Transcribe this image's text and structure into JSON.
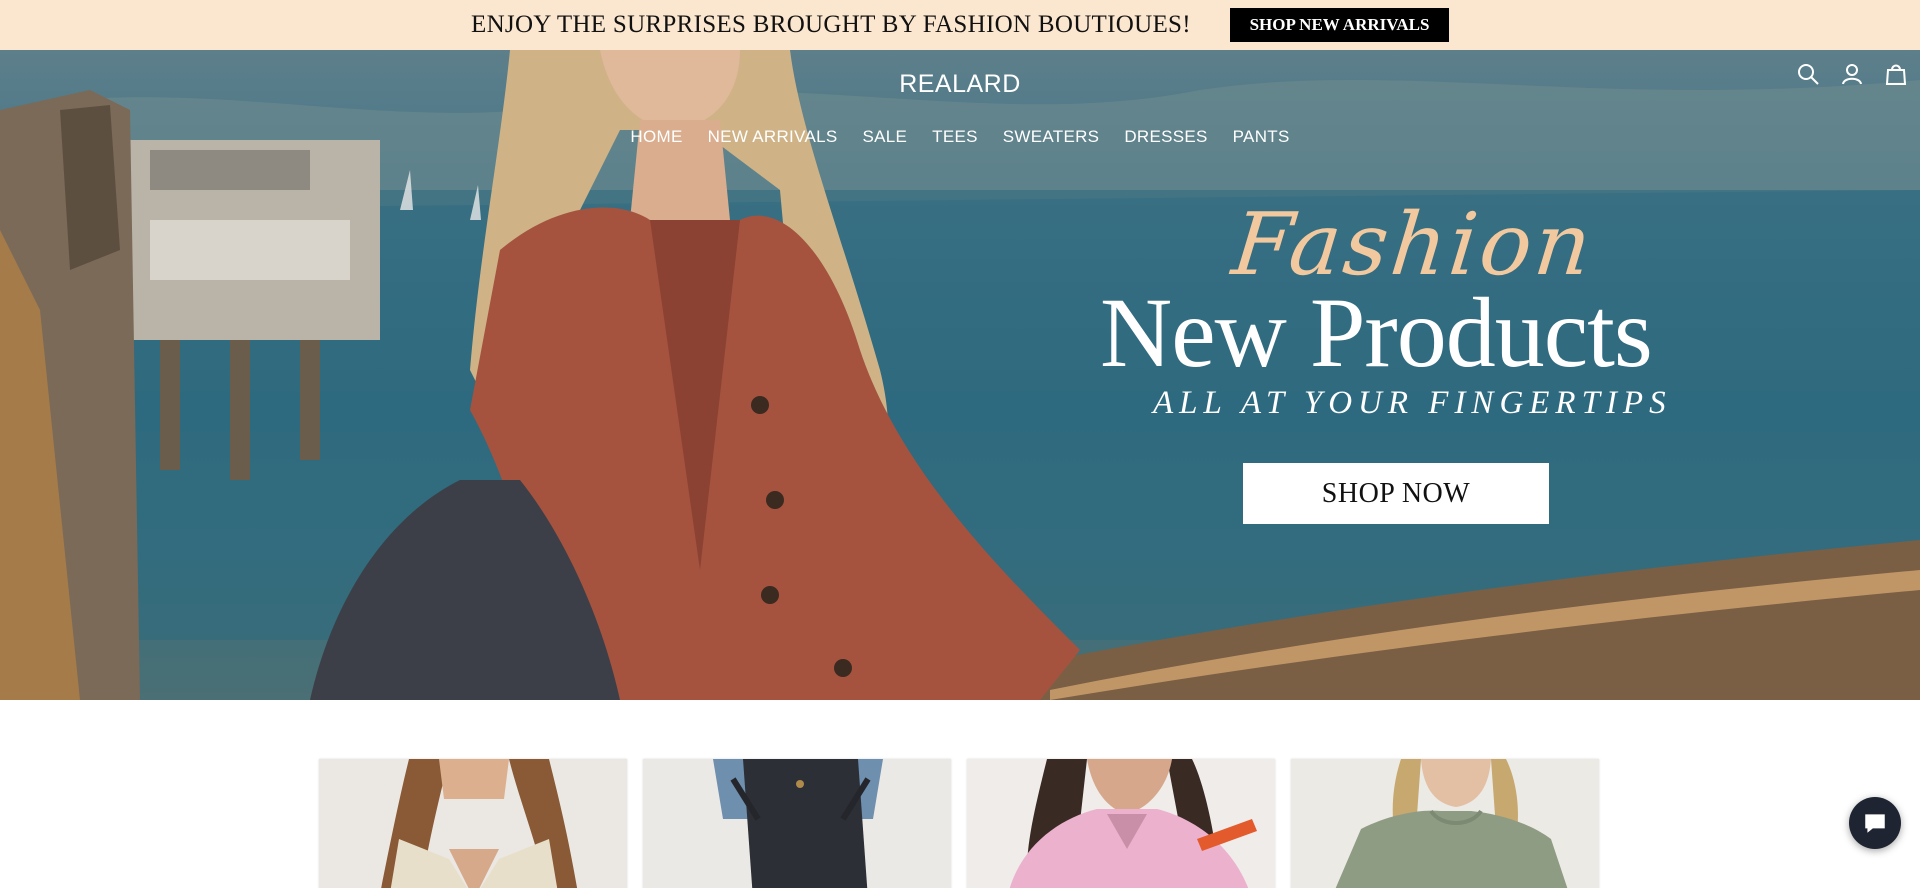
{
  "announcement": {
    "text": "ENJOY THE SURPRISES BROUGHT BY FASHION BOUTIOUES!",
    "button_label": "SHOP NEW ARRIVALS",
    "background": "#fbe6cf"
  },
  "header": {
    "brand": "REALARD",
    "nav": [
      "HOME",
      "NEW ARRIVALS",
      "SALE",
      "TEES",
      "SWEATERS",
      "DRESSES",
      "PANTS"
    ],
    "icons": [
      "search-icon",
      "account-icon",
      "cart-icon"
    ]
  },
  "hero": {
    "script_title": "Fashion",
    "title": "New Products",
    "subtitle": "ALL AT YOUR FINGERTIPS",
    "cta_label": "SHOP NOW",
    "accent": "#f2c89e"
  },
  "products": [
    {
      "name": "product-card-cream-top"
    },
    {
      "name": "product-card-black-pants"
    },
    {
      "name": "product-card-pink-sweater"
    },
    {
      "name": "product-card-sage-tee"
    }
  ],
  "chat": {
    "icon": "chat-icon"
  }
}
